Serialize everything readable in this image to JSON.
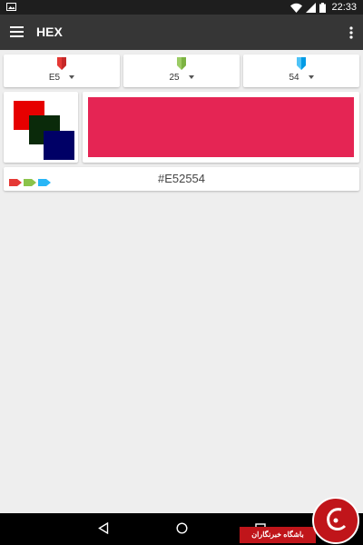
{
  "status_bar": {
    "time": "22:33",
    "icons": [
      "image-icon",
      "wifi-icon",
      "signal-icon",
      "battery-icon"
    ]
  },
  "app_bar": {
    "title": "HEX",
    "menu_icon": "hamburger-menu-icon",
    "overflow_icon": "more-vert-icon"
  },
  "channels": [
    {
      "name": "red",
      "value": "E5",
      "tag_color": "#e53935"
    },
    {
      "name": "green",
      "value": "25",
      "tag_color": "#8bc34a"
    },
    {
      "name": "blue",
      "value": "54",
      "tag_color": "#29b6f6"
    }
  ],
  "preview": {
    "red_square": "#e60000",
    "green_square": "#0a2a0a",
    "blue_square": "#000066"
  },
  "swatch": {
    "color": "#E52554"
  },
  "hex_bar": {
    "value": "#E52554"
  },
  "watermark": {
    "banner_text": "باشگاه خبرنگاران"
  },
  "nav_bar": {
    "icons": [
      "back-icon",
      "home-icon",
      "recents-icon"
    ]
  }
}
